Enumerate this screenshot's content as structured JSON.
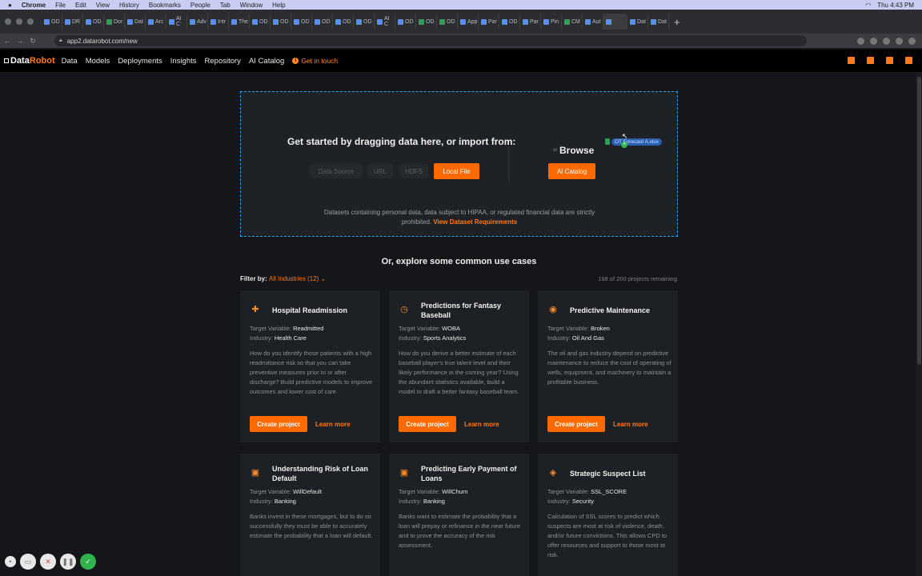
{
  "mac_menu": {
    "app": "Chrome",
    "items": [
      "File",
      "Edit",
      "View",
      "History",
      "Bookmarks",
      "People",
      "Tab",
      "Window",
      "Help"
    ],
    "clock": "Thu 4:43 PM"
  },
  "browser": {
    "tabs": [
      "OD",
      "DR",
      "OD",
      "Dor",
      "Dat",
      "Arc",
      "AI C",
      "Adv",
      "Intr",
      "The",
      "OD",
      "OD",
      "OD",
      "OD",
      "OD",
      "OD",
      "AI C",
      "OD",
      "OD",
      "OD",
      "App",
      "Par",
      "OD",
      "Par",
      "Pin",
      "CM",
      "Aut",
      "",
      "Dat",
      "Dat"
    ],
    "url": "app2.datarobot.com/new"
  },
  "app": {
    "logo_data": "Data",
    "logo_robot": "Robot",
    "nav": [
      "Data",
      "Models",
      "Deployments",
      "Insights",
      "Repository",
      "AI Catalog"
    ],
    "get_in_touch": "Get in touch"
  },
  "dropzone": {
    "title": "Get started by dragging data here, or import from:",
    "or": "or",
    "browse": "Browse",
    "buttons": {
      "data_source": "Data Source",
      "url": "URL",
      "hdfs": "HDFS",
      "local_file": "Local File",
      "ai_catalog": "AI Catalog"
    },
    "note": "Datasets containing personal data, data subject to HIPAA, or regulated financial data are strictly prohibited.",
    "note_link": "View Dataset Requirements",
    "dragged_file": "OT Forecast A.xlsx"
  },
  "use_cases": {
    "title": "Or, explore some common use cases",
    "filter_label": "Filter by:",
    "filter_value": "All Industries (12)",
    "remaining": "198 of 200 projects remaining",
    "target_label": "Target Variable:",
    "industry_label": "Industry:",
    "create_label": "Create project",
    "learn_label": "Learn more",
    "cards": [
      {
        "title": "Hospital Readmission",
        "target": "Readmitted",
        "industry": "Health Care",
        "desc": "How do you identify those patients with a high readmittance risk so that you can take preventive measures prior to or after discharge? Build predictive models to improve outcomes and lower cost of care.",
        "icon": "hospital-icon"
      },
      {
        "title": "Predictions for Fantasy Baseball",
        "target": "WOBA",
        "industry": "Sports Analytics",
        "desc": "How do you derive a better estimate of each baseball player's true talent level and their likely performance in the coming year? Using the abundant statistics available, build a model to draft a better fantasy baseball team.",
        "icon": "stopwatch-icon"
      },
      {
        "title": "Predictive Maintenance",
        "target": "Broken",
        "industry": "Oil And Gas",
        "desc": "The oil and gas industry depend on predictive maintenance to reduce the cost of operating of wells, equipment, and machinery to maintain a profitable business.",
        "icon": "oil-drop-icon"
      },
      {
        "title": "Understanding Risk of Loan Default",
        "target": "WillDefault",
        "industry": "Banking",
        "desc": "Banks invest in these mortgages, but to do so successfully they must be able to accurately estimate the probability that a loan will default.",
        "icon": "bank-icon"
      },
      {
        "title": "Predicting Early Payment of Loans",
        "target": "WillChurn",
        "industry": "Banking",
        "desc": "Banks want to estimate the probability that a loan will prepay or refinance in the near future and to prove the accuracy of the risk assessment.",
        "icon": "bank-icon"
      },
      {
        "title": "Strategic Suspect List",
        "target": "SSL_SCORE",
        "industry": "Security",
        "desc": "Calculation of SSL scores to predict which suspects are most at risk of violence, death, and/or future convictions. This allows CPD to offer resources and support to those most at risk.",
        "icon": "shield-icon"
      }
    ]
  }
}
